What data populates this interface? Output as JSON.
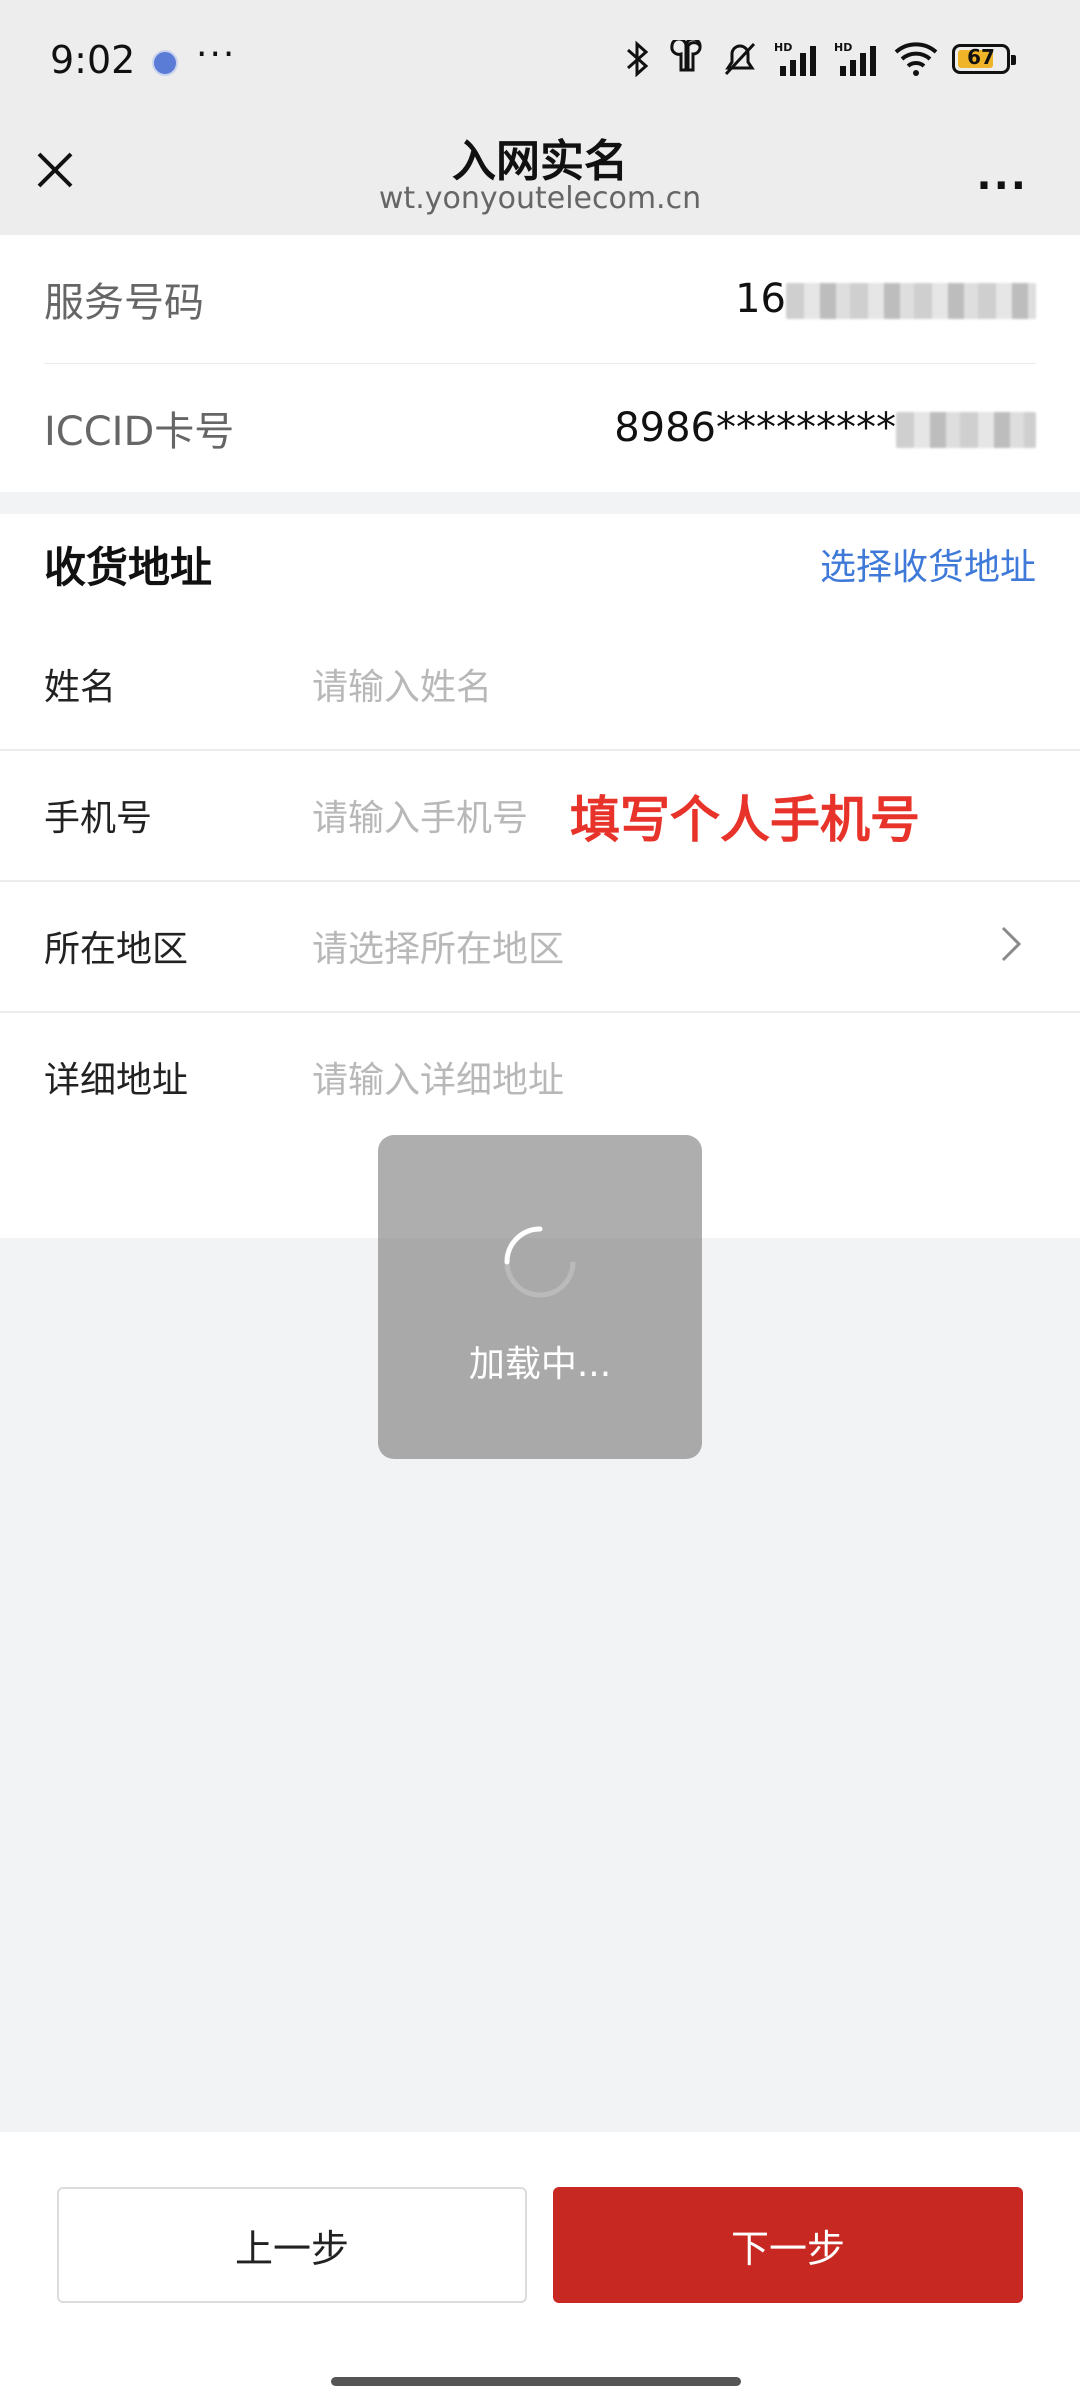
{
  "status_bar": {
    "time": "9:02",
    "more": "···",
    "battery_level": "67",
    "icons": [
      "app-badge-icon",
      "bluetooth-icon",
      "earbuds-icon",
      "mute-icon",
      "signal-hd-1-icon",
      "signal-hd-2-icon",
      "wifi-icon",
      "battery-icon"
    ]
  },
  "nav": {
    "title": "入网实名",
    "subtitle": "wt.yonyoutelecom.cn",
    "more": "···"
  },
  "card_info": {
    "service_number_label": "服务号码",
    "service_number_value": "16",
    "iccid_label": "ICCID卡号",
    "iccid_value": "8986*********"
  },
  "shipping": {
    "title": "收货地址",
    "select_link": "选择收货地址",
    "fields": [
      {
        "label": "姓名",
        "placeholder": "请输入姓名"
      },
      {
        "label": "手机号",
        "placeholder": "请输入手机号"
      },
      {
        "label": "所在地区",
        "placeholder": "请选择所在地区"
      },
      {
        "label": "详细地址",
        "placeholder": "请输入详细地址"
      }
    ]
  },
  "annotation": "填写个人手机号",
  "loading": {
    "text": "加载中..."
  },
  "buttons": {
    "prev": "上一步",
    "next": "下一步"
  },
  "colors": {
    "accent_red": "#c72822",
    "link_blue": "#3f7ad9",
    "annotation_red": "#e8332a"
  }
}
